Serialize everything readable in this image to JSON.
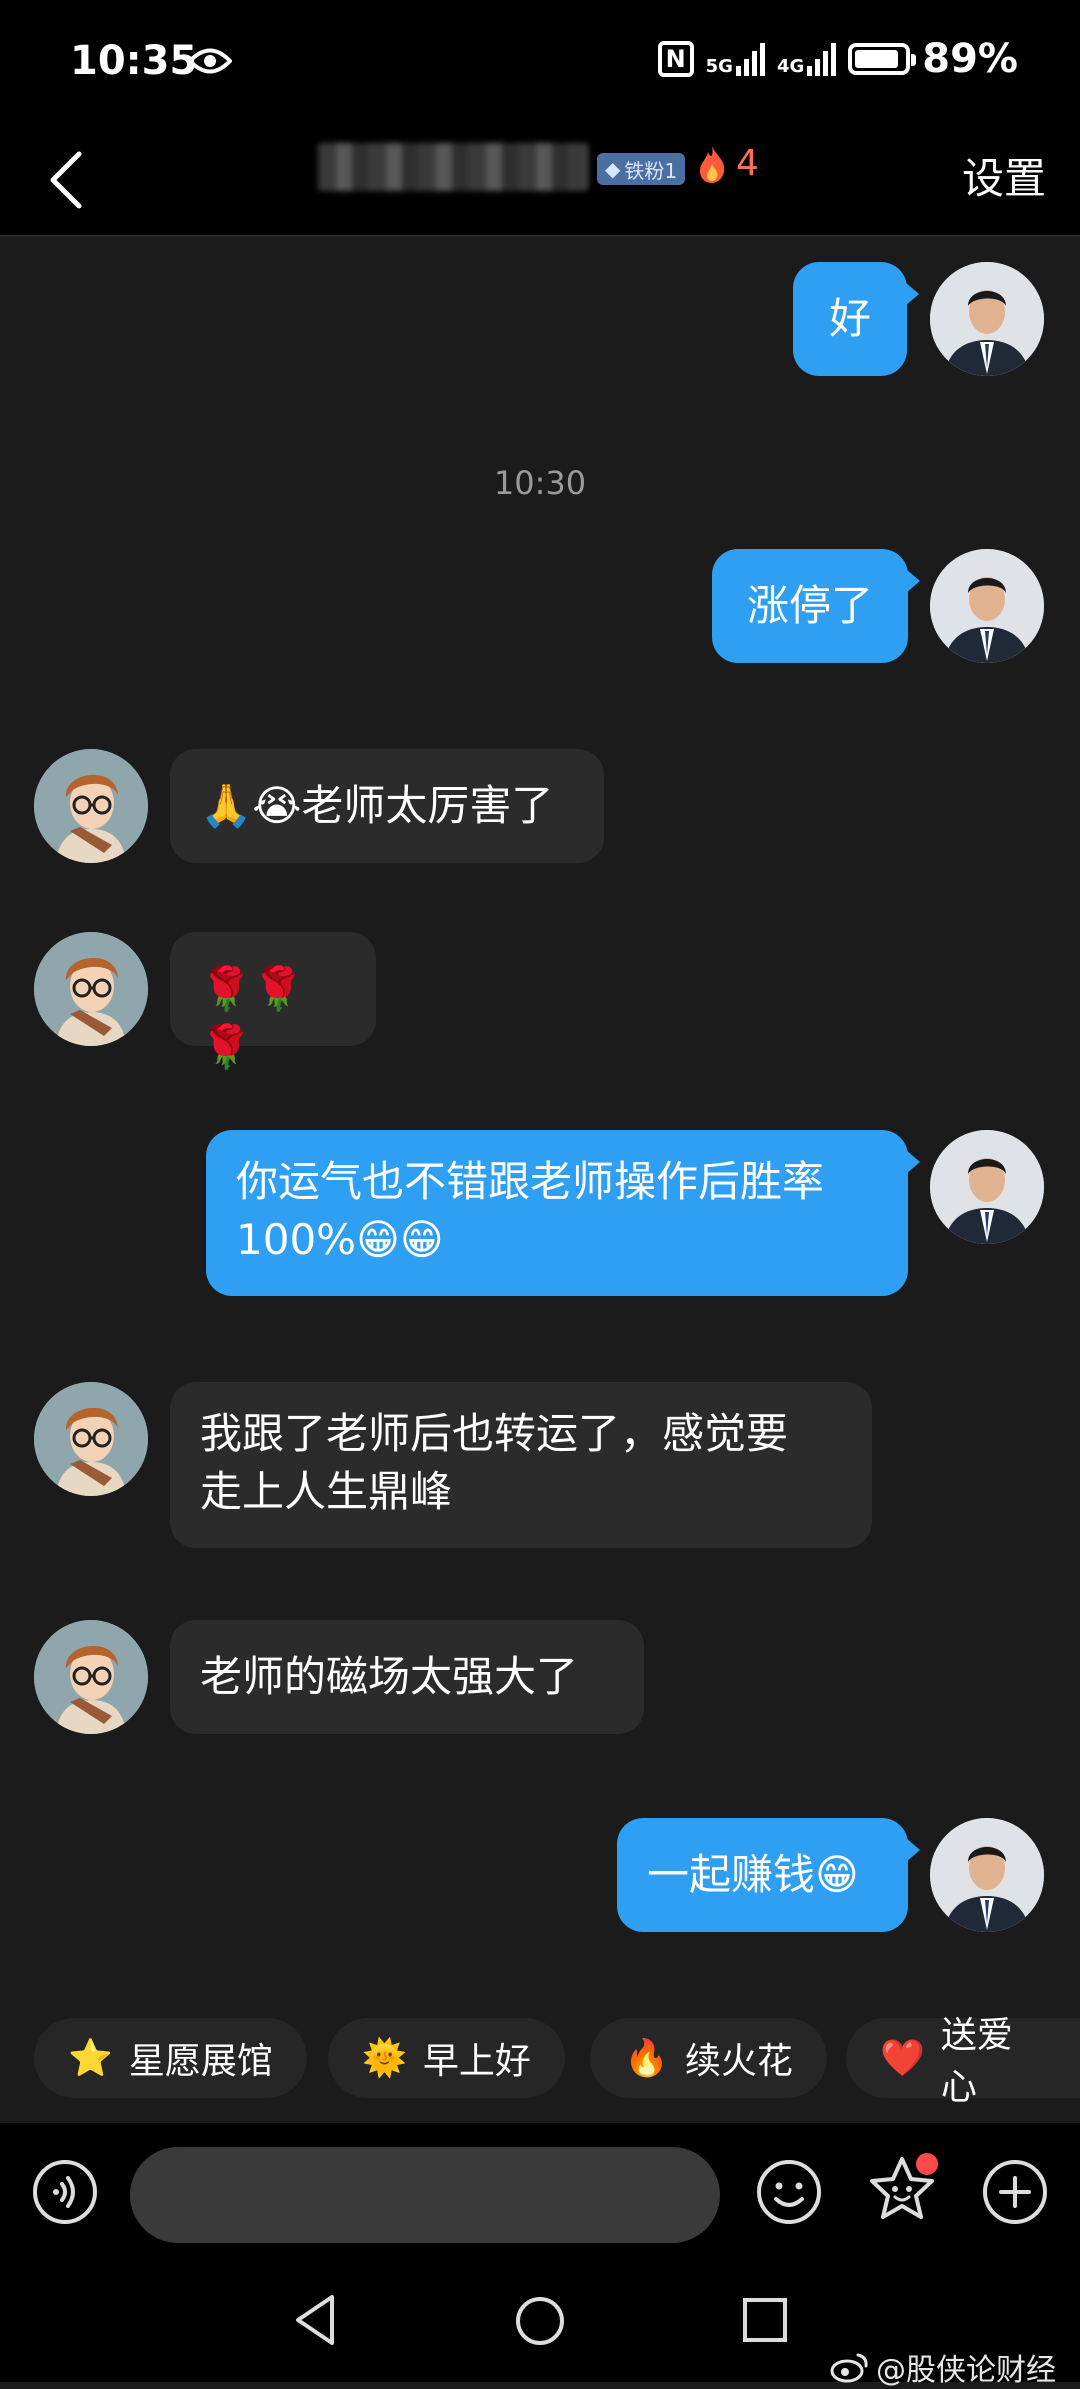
{
  "status_bar": {
    "time": "10:35",
    "net_5g": "5G",
    "net_4g": "4G",
    "battery_percent": "89%",
    "battery_level": 0.89
  },
  "header": {
    "fan_badge": "铁粉1",
    "fire_count": "4",
    "settings_label": "设置"
  },
  "chat": {
    "timestamp": "10:30",
    "messages": [
      {
        "from": "me",
        "text": "好"
      },
      {
        "from": "me",
        "text": "涨停了"
      },
      {
        "from": "other",
        "text": "🙏😭老师太厉害了"
      },
      {
        "from": "other",
        "text": "🌹🌹🌹"
      },
      {
        "from": "me",
        "line1": "你运气也不错跟老师操作后胜率",
        "line2": "100%😁😁"
      },
      {
        "from": "other",
        "line1": "我跟了老师后也转运了，感觉要",
        "line2": "走上人生鼎峰"
      },
      {
        "from": "other",
        "text": "老师的磁场太强大了"
      },
      {
        "from": "me",
        "text": "一起赚钱😁"
      }
    ]
  },
  "quick_replies": [
    {
      "icon": "⭐",
      "label": "星愿展馆"
    },
    {
      "icon": "🌞",
      "label": "早上好"
    },
    {
      "icon": "🔥",
      "label": "续火花"
    },
    {
      "icon": "❤️",
      "label": "送爱心"
    }
  ],
  "input": {
    "value": ""
  },
  "watermark": "@股侠论财经",
  "colors": {
    "my_bubble": "#2f9ff4",
    "other_bubble": "#2b2b2b",
    "background": "#1b1b1b"
  }
}
